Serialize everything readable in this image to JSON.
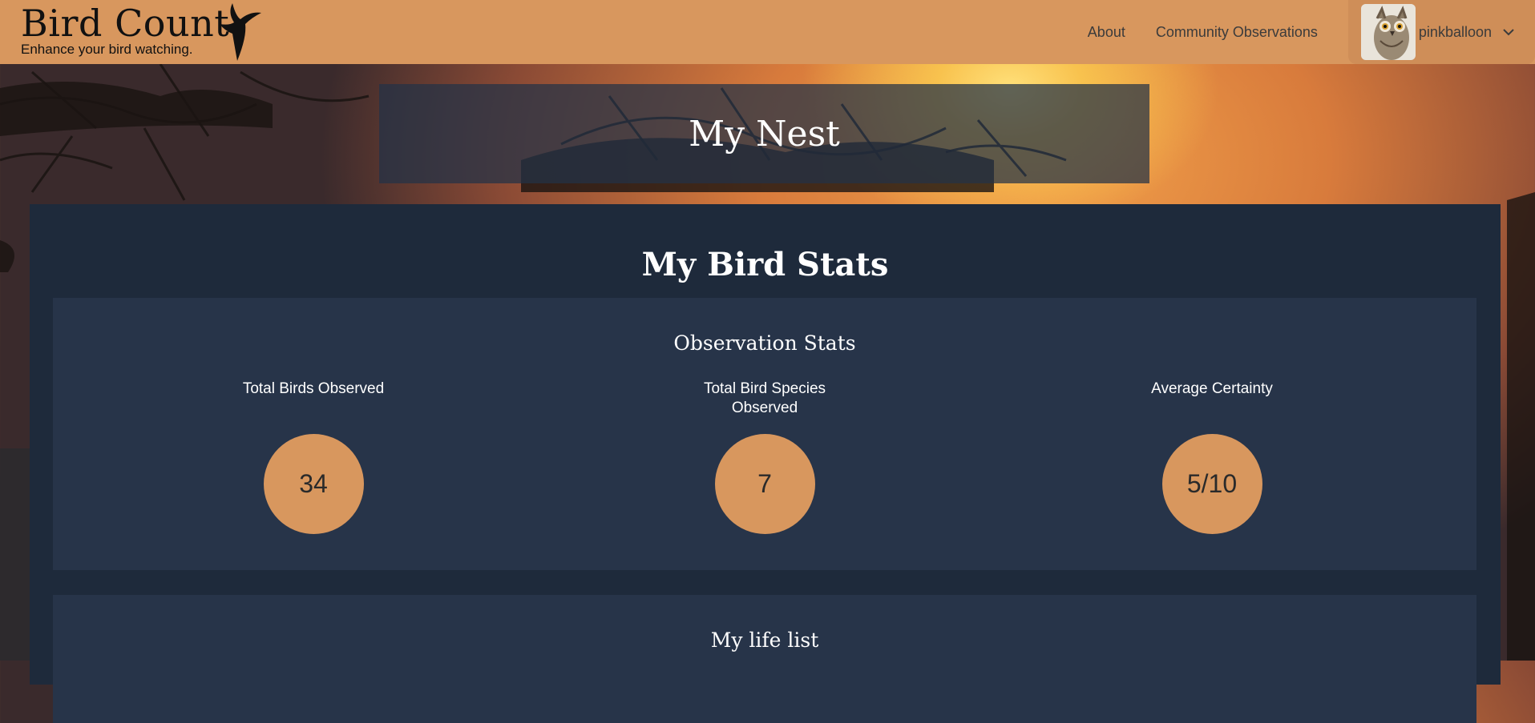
{
  "brand": {
    "title": "Bird Count",
    "tagline": "Enhance your bird watching."
  },
  "nav": {
    "links": [
      {
        "label": "About"
      },
      {
        "label": "Community Observations"
      }
    ],
    "user": {
      "username": "pinkballoon"
    }
  },
  "hero": {
    "title": "My Nest"
  },
  "stats_section": {
    "title": "My Bird Stats",
    "observation_card": {
      "title": "Observation Stats",
      "stats": [
        {
          "label": "Total Birds Observed",
          "value": "34"
        },
        {
          "label": "Total Bird Species Observed",
          "value": "7"
        },
        {
          "label": "Average Certainty",
          "value": "5/10"
        }
      ]
    },
    "life_list": {
      "title": "My life list"
    }
  },
  "colors": {
    "nav_background": "#d8975e",
    "panel_background": "#1e2a3b",
    "card_background": "#273449",
    "stat_circle": "#d8975e"
  },
  "icons": [
    "bird-logo-icon",
    "owl-avatar-image",
    "chevron-down-icon"
  ]
}
